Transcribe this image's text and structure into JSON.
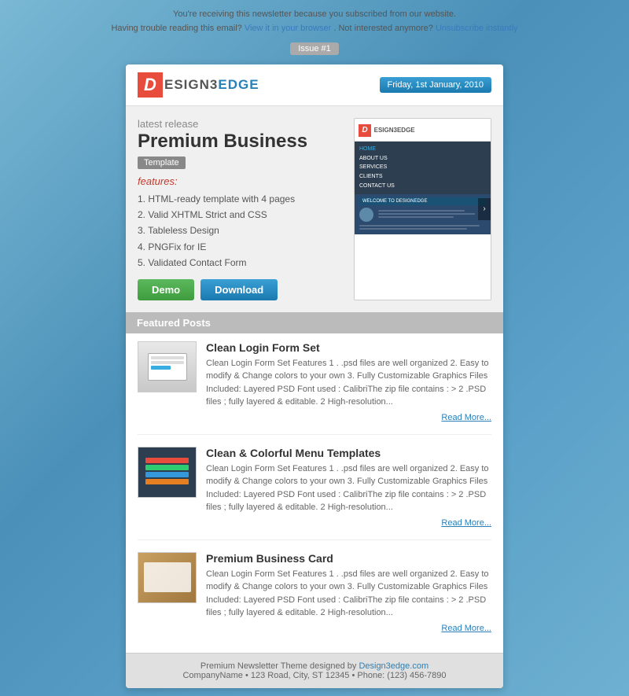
{
  "topbar": {
    "line1": "You're receiving this newsletter because you subscribed from our website.",
    "line2_pre": "Having trouble reading this email?",
    "view_link": "View it in your browser",
    "line2_mid": ". Not interested anymore?",
    "unsub_link": "Unsubscribe instantly"
  },
  "issue": {
    "badge": "Issue #1"
  },
  "header": {
    "logo_letter": "D",
    "logo_name": "ESIGN3",
    "logo_edge": "EDGE",
    "date": "Friday, 1st January, 2010"
  },
  "hero": {
    "latest_release": "latest release",
    "product_title": "Premium Business",
    "template_label": "Template",
    "features_label": "features:",
    "features": [
      "HTML-ready template with 4 pages",
      "Valid XHTML Strict and CSS",
      "Tableless Design",
      "PNGFix for IE",
      "Validated Contact Form"
    ],
    "btn_demo": "Demo",
    "btn_download": "Download"
  },
  "preview": {
    "nav_items": [
      "HOME",
      "ABOUT US",
      "SERVICES",
      "CLIENTS",
      "CONTACT US"
    ],
    "welcome_text": "WELCOME TO DESIGNEDGE"
  },
  "featured": {
    "header": "Featured Posts",
    "posts": [
      {
        "title": "Clean Login Form Set",
        "desc": "Clean Login Form Set Features 1 . .psd files are well organized 2. Easy to modify & Change colors to your own 3. Fully Customizable Graphics Files Included: Layered PSD Font used : CalibriThe zip file contains : > 2 .PSD files ; fully layered & editable. 2 High-resolution...",
        "read_more": "Read More...",
        "thumb_type": "login"
      },
      {
        "title": "Clean & Colorful Menu Templates",
        "desc": "Clean Login Form Set Features 1 . .psd files are well organized 2. Easy to modify & Change colors to your own 3. Fully Customizable Graphics Files Included: Layered PSD Font used : CalibriThe zip file contains : > 2 .PSD files ; fully layered & editable. 2 High-resolution...",
        "read_more": "Read More...",
        "thumb_type": "menu"
      },
      {
        "title": "Premium Business Card",
        "desc": "Clean Login Form Set Features 1 . .psd files are well organized 2. Easy to modify & Change colors to your own 3. Fully Customizable Graphics Files Included: Layered PSD Font used : CalibriThe zip file contains : > 2 .PSD files ; fully layered & editable. 2 High-resolution...",
        "read_more": "Read More...",
        "thumb_type": "card"
      }
    ]
  },
  "footer": {
    "line1_pre": "Premium Newsletter Theme designed by",
    "design_link": "Design3edge.com",
    "line2": "CompanyName • 123 Road, City, ST 12345 • Phone: (123) 456-7890"
  }
}
